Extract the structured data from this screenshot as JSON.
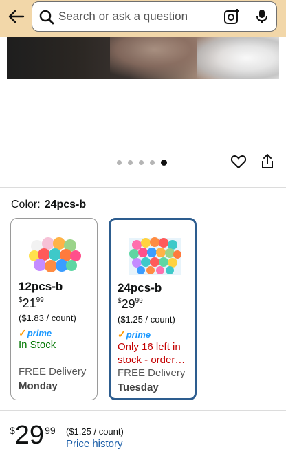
{
  "header": {
    "search_placeholder": "Search or ask a question"
  },
  "icons": {
    "back": "back-arrow-icon",
    "search": "search-icon",
    "lens": "camera-lens-icon",
    "mic": "microphone-icon",
    "heart": "heart-icon",
    "share": "share-icon"
  },
  "gallery": {
    "dot_count": 5,
    "active_index": 4
  },
  "color": {
    "label": "Color:",
    "value": "24pcs-b"
  },
  "variants": [
    {
      "name": "12pcs-b",
      "price_symbol": "$",
      "price_whole": "21",
      "price_fraction": "99",
      "unit_price": "($1.83 / count)",
      "prime": "prime",
      "stock": "In Stock",
      "delivery": "FREE Delivery",
      "day": "Monday",
      "selected": false
    },
    {
      "name": "24pcs-b",
      "price_symbol": "$",
      "price_whole": "29",
      "price_fraction": "99",
      "unit_price": "($1.25 / count)",
      "prime": "prime",
      "stock": "Only 16 left in stock - order…",
      "delivery": "FREE Delivery",
      "day": "Tuesday",
      "selected": true
    }
  ],
  "buybox": {
    "price_symbol": "$",
    "price_whole": "29",
    "price_fraction": "99",
    "unit_price": "($1.25 / count)",
    "price_history": "Price history"
  },
  "colors": {
    "header_bg": "#f2d7a9",
    "selected_border": "#2d5d8f",
    "in_stock": "#007600",
    "low_stock": "#c40000",
    "prime_blue": "#1a98ff",
    "link": "#1b5ea8"
  }
}
